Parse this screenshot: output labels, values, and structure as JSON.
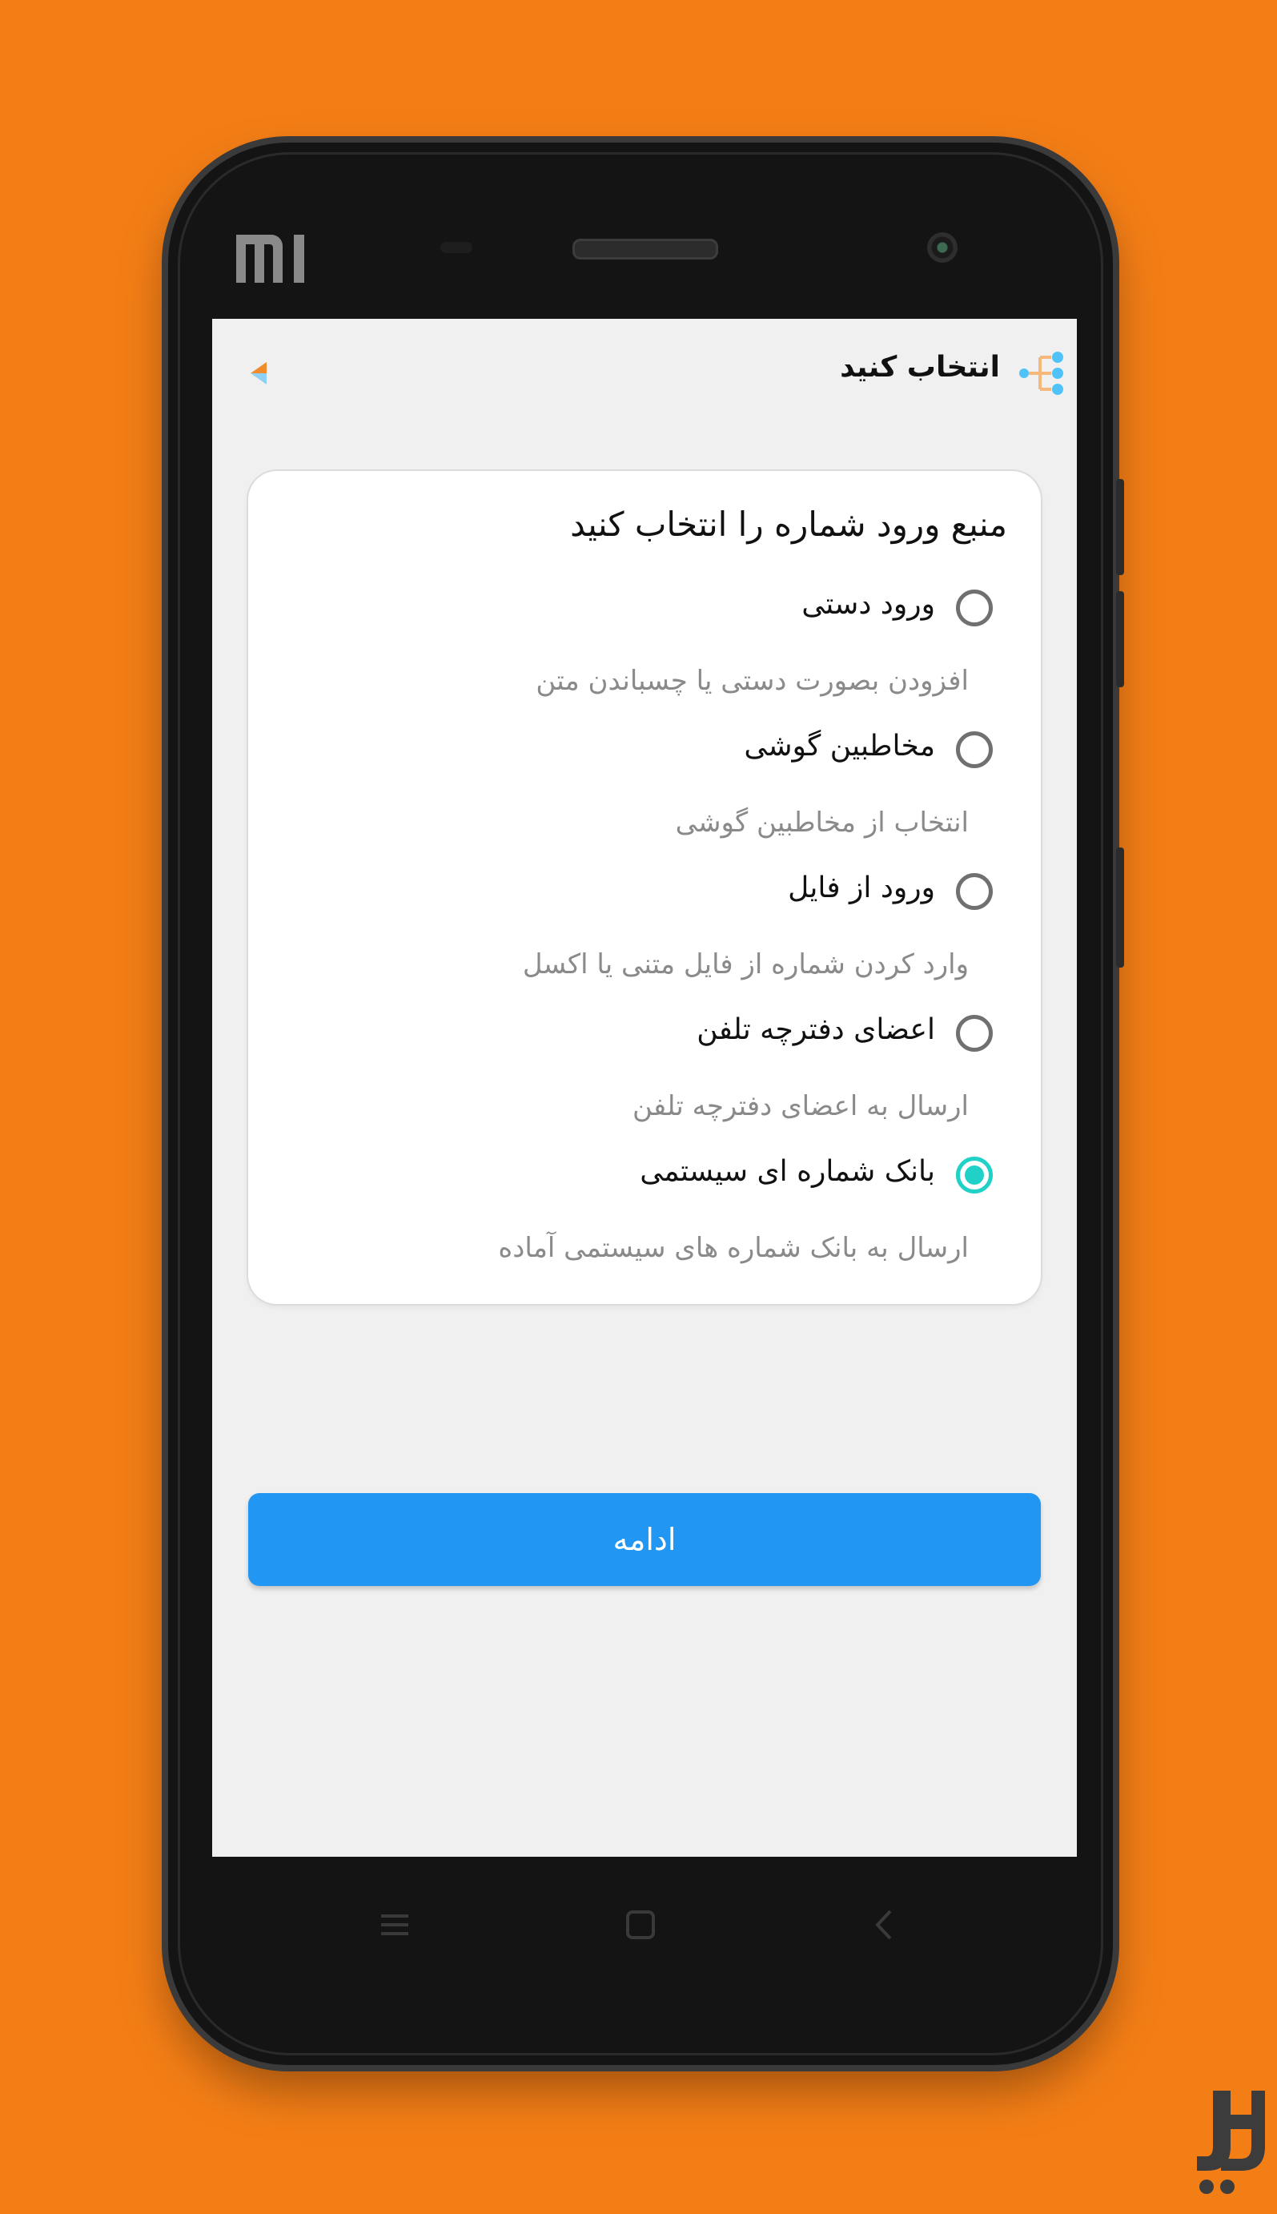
{
  "appbar": {
    "title": "انتخاب کنید",
    "icon": "tree-share-icon",
    "back_icon": "back-arrow-icon"
  },
  "card": {
    "title": "منبع ورود شماره را انتخاب کنید",
    "options": [
      {
        "label": "ورود دستی",
        "description": "افزودن بصورت دستی یا چسباندن متن",
        "selected": false
      },
      {
        "label": "مخاطبین گوشی",
        "description": "انتخاب از مخاطبین گوشی",
        "selected": false
      },
      {
        "label": "ورود از فایل",
        "description": "وارد کردن شماره از فایل متنی یا اکسل",
        "selected": false
      },
      {
        "label": "اعضای دفترچه تلفن",
        "description": "ارسال به اعضای دفترچه تلفن",
        "selected": false
      },
      {
        "label": "بانک شماره ای سیستمی",
        "description": "ارسال به بانک شماره های سیستمی آماده",
        "selected": true
      }
    ]
  },
  "continue_button": {
    "label": "ادامه"
  },
  "colors": {
    "background": "#f47e16",
    "primary": "#2196f3",
    "radio_selected": "#1fd1c7",
    "screen_bg": "#f0f0f0"
  }
}
